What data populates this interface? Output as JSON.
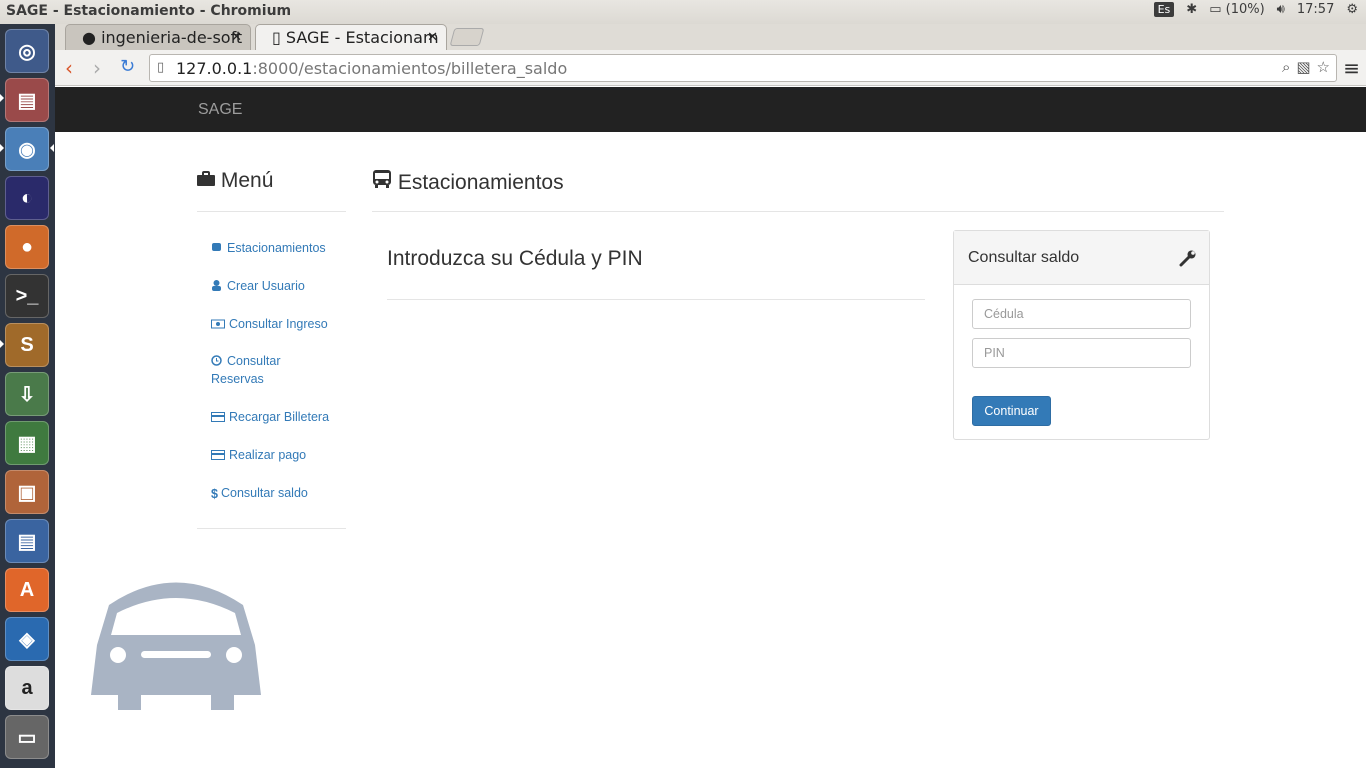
{
  "system": {
    "window_title": "SAGE - Estacionamiento - Chromium",
    "keyboard": "Es",
    "battery": "(10%)",
    "clock": "17:57"
  },
  "browser": {
    "tabs": [
      {
        "label": "ingenieria-de-soft",
        "active": false
      },
      {
        "label": "SAGE - Estacionam",
        "active": true
      }
    ],
    "url_host": "127.0.0.1",
    "url_rest": ":8000/estacionamientos/billetera_saldo"
  },
  "launcher": {
    "icons": [
      "ubuntu-dash-icon",
      "files-icon",
      "chromium-icon",
      "eclipse-icon",
      "firefox-icon",
      "terminal-icon",
      "sublime-text-icon",
      "update-icon",
      "calc-icon",
      "impress-icon",
      "writer-icon",
      "software-center-icon",
      "dropbox-icon",
      "amazon-icon",
      "trash-icon"
    ]
  },
  "navbar": {
    "brand": "SAGE"
  },
  "sidebar": {
    "title": "Menú",
    "items": [
      {
        "label": "Estacionamientos",
        "icon": "bus-icon"
      },
      {
        "label": "Crear Usuario",
        "icon": "user-icon"
      },
      {
        "label": "Consultar Ingreso",
        "icon": "money-icon"
      },
      {
        "label": "Consultar",
        "label2": "Reservas",
        "icon": "clock-icon"
      },
      {
        "label": "Recargar Billetera",
        "icon": "card-icon"
      },
      {
        "label": "Realizar pago",
        "icon": "card-icon"
      },
      {
        "label": "Consultar saldo",
        "icon": "dollar-icon"
      }
    ]
  },
  "main": {
    "title": "Estacionamientos",
    "subtitle": "Introduzca su Cédula y PIN"
  },
  "panel": {
    "title": "Consultar saldo",
    "cedula_placeholder": "Cédula",
    "pin_placeholder": "PIN",
    "button": "Continuar"
  },
  "colors": {
    "link": "#337ab7",
    "navbar": "#222222",
    "button": "#337ab7"
  }
}
